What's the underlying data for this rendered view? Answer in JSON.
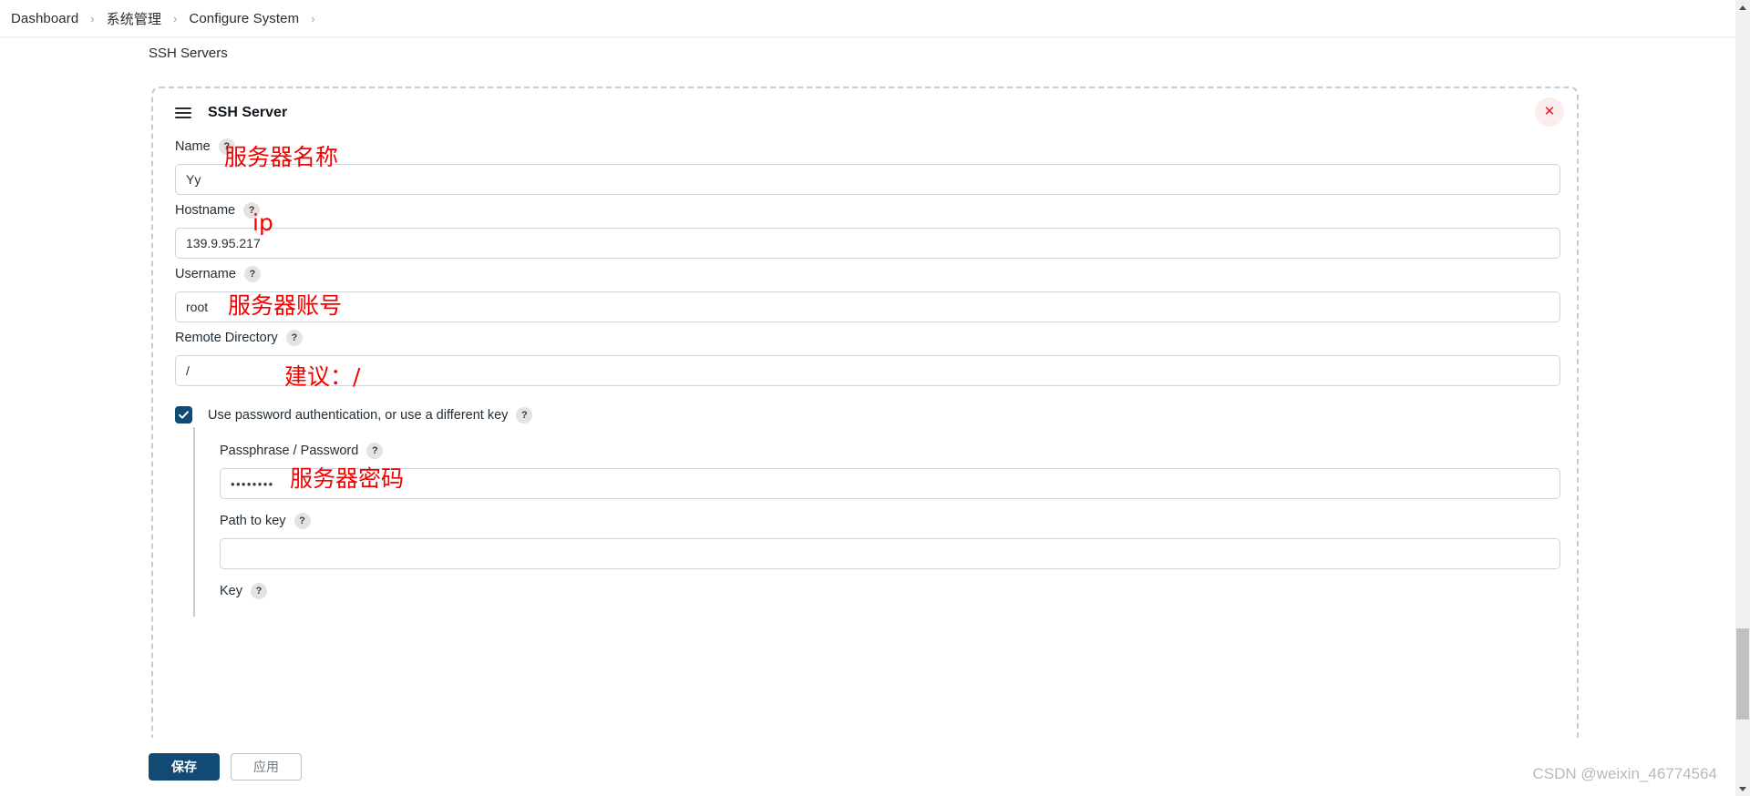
{
  "breadcrumb": {
    "items": [
      {
        "label": "Dashboard"
      },
      {
        "label": "系统管理"
      },
      {
        "label": "Configure System"
      }
    ],
    "separator": "›"
  },
  "section": {
    "label": "SSH Servers"
  },
  "card": {
    "title": "SSH Server",
    "drag_handle_icon": "hamburger-icon",
    "close_icon": "✕",
    "help_glyph": "?"
  },
  "fields": {
    "name": {
      "label": "Name",
      "value": "Yy",
      "annotation": "服务器名称"
    },
    "hostname": {
      "label": "Hostname",
      "value": "139.9.95.217",
      "annotation": "ip"
    },
    "username": {
      "label": "Username",
      "value": "root",
      "annotation": "服务器账号"
    },
    "remote_directory": {
      "label": "Remote Directory",
      "value": "/",
      "annotation": "建议：/"
    },
    "use_password_auth": {
      "label": "Use password authentication, or use a different key",
      "checked": true
    },
    "passphrase": {
      "label": "Passphrase / Password",
      "value": "••••••••",
      "annotation": "服务器密码"
    },
    "path_to_key": {
      "label": "Path to key",
      "value": ""
    },
    "key": {
      "label": "Key",
      "value": ""
    }
  },
  "footer": {
    "save_label": "保存",
    "apply_label": "应用"
  },
  "watermark": {
    "text": "CSDN @weixin_46774564"
  },
  "colors": {
    "primary": "#114a72",
    "danger": "#e0172a",
    "annotation": "#f50000",
    "input_border": "#ccd5da",
    "dashed_border": "#c3ccd2"
  }
}
